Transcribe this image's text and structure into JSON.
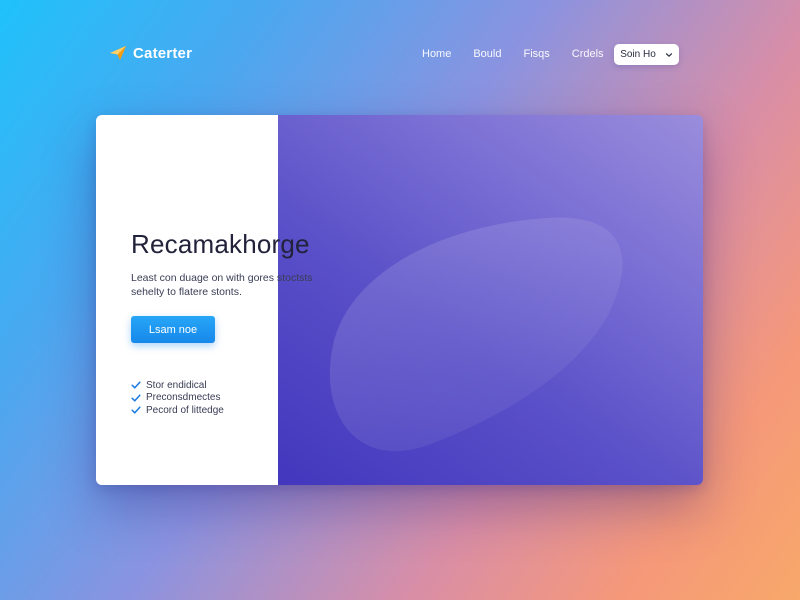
{
  "brand": {
    "name": "Caterter"
  },
  "nav": {
    "links": [
      "Home",
      "Bould",
      "Fisqs",
      "Crdels"
    ],
    "cta": {
      "label": "Soin Ho"
    }
  },
  "hero": {
    "title": "Recamakhorge",
    "subtitle_lines": [
      "Least con duage on with gores stoctsts",
      "sehelty to flatere stonts."
    ],
    "button_label": "Lsam noe",
    "features": [
      "Stor endidical",
      "Preconsdmectes",
      "Pecord of littedge"
    ]
  },
  "colors": {
    "accent_blue": "#1b8cf0",
    "panel_purple": "#5a50c8",
    "check_color": "#1a7ae0",
    "logo_orange": "#f5a623"
  },
  "icons": {
    "logo": "paper-plane-icon",
    "dropdown": "chevron-down-icon",
    "feature_bullet": "check-icon"
  }
}
